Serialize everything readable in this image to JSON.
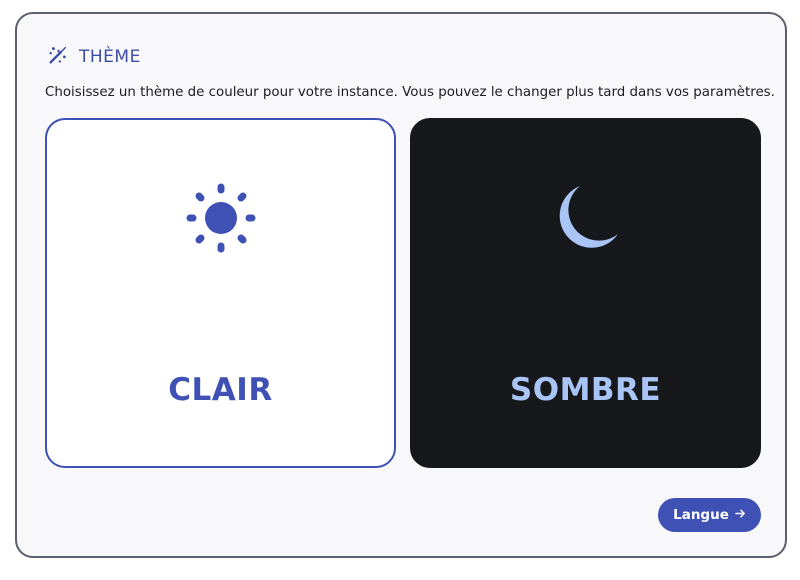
{
  "header": {
    "title": "THÈME",
    "icon": "theme-palette-icon"
  },
  "description": "Choisissez un thème de couleur pour votre instance. Vous pouvez le changer plus tard dans vos paramètres.",
  "themes": [
    {
      "label": "CLAIR",
      "icon": "sun-icon",
      "selected": true,
      "color": "#3f51b5"
    },
    {
      "label": "SOMBRE",
      "icon": "moon-icon",
      "selected": false,
      "color": "#a9c5f5",
      "background": "#17181c"
    }
  ],
  "footer": {
    "next_label": "Langue",
    "next_icon": "arrow-right-icon"
  },
  "colors": {
    "accent": "#3f51b5",
    "dark_card": "#17181c",
    "moon": "#a9c5f5"
  }
}
